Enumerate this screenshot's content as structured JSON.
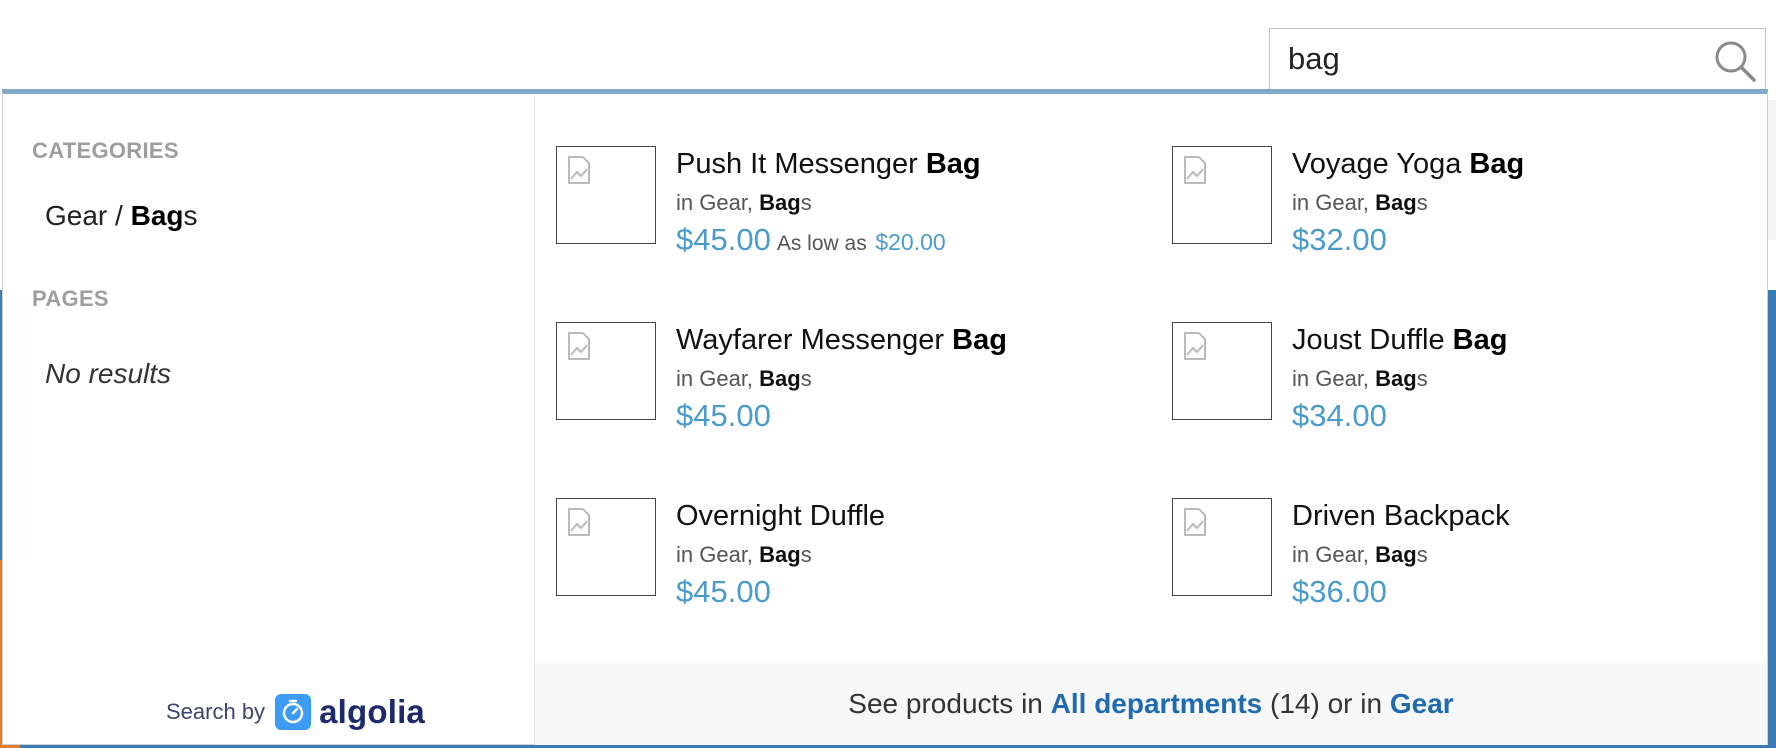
{
  "search": {
    "query": "bag",
    "placeholder": ""
  },
  "sidebar": {
    "categories_heading": "CATEGORIES",
    "category_item": {
      "prefix": "Gear / ",
      "match": "Bag",
      "suffix": "s"
    },
    "pages_heading": "PAGES",
    "pages_empty": "No results",
    "search_by_label": "Search by",
    "logo_text": "algolia"
  },
  "products": [
    {
      "name_prefix": "Push It Messenger ",
      "name_match": "Bag",
      "cat_prefix": "in Gear, ",
      "cat_match": "Bag",
      "cat_suffix": "s",
      "price": "$45.00",
      "low_label": "As low as",
      "low_price": "$20.00"
    },
    {
      "name_prefix": "Voyage Yoga ",
      "name_match": "Bag",
      "cat_prefix": "in Gear, ",
      "cat_match": "Bag",
      "cat_suffix": "s",
      "price": "$32.00"
    },
    {
      "name_prefix": "Wayfarer Messenger ",
      "name_match": "Bag",
      "cat_prefix": "in Gear, ",
      "cat_match": "Bag",
      "cat_suffix": "s",
      "price": "$45.00"
    },
    {
      "name_prefix": "Joust Duffle ",
      "name_match": "Bag",
      "cat_prefix": "in Gear, ",
      "cat_match": "Bag",
      "cat_suffix": "s",
      "price": "$34.00"
    },
    {
      "name_prefix": "Overnight Duffle",
      "name_match": "",
      "cat_prefix": "in Gear, ",
      "cat_match": "Bag",
      "cat_suffix": "s",
      "price": "$45.00"
    },
    {
      "name_prefix": "Driven Backpack",
      "name_match": "",
      "cat_prefix": "in Gear, ",
      "cat_match": "Bag",
      "cat_suffix": "s",
      "price": "$36.00"
    }
  ],
  "footer": {
    "prefix": "See products in ",
    "all_link": "All departments",
    "count": " (14) or in ",
    "gear_link": "Gear"
  },
  "colors": {
    "price": "#4a9ccc",
    "link": "#1f6bb0",
    "dropdown_top_border": "#7fa8c9",
    "heading_gray": "#9e9e9e"
  },
  "icons": {
    "search": "magnifier-icon",
    "thumbnail": "image-placeholder-icon",
    "algolia": "algolia-stopwatch-icon"
  }
}
